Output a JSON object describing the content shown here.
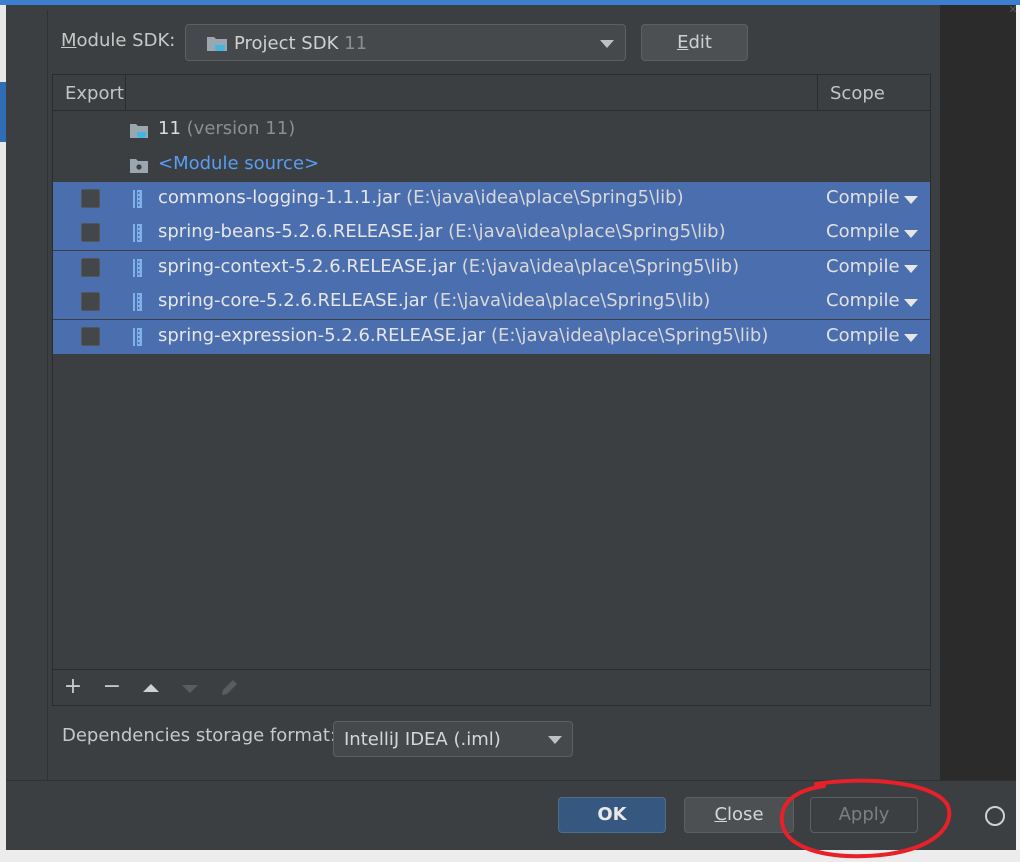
{
  "sdk": {
    "label_mnemonic": "M",
    "label_rest": "odule SDK:",
    "value_name": "Project SDK",
    "value_version": "11",
    "edit_mnemonic": "E",
    "edit_rest": "dit"
  },
  "table": {
    "headers": {
      "export": "Export",
      "scope": "Scope"
    },
    "sdk_entry": {
      "name": "11",
      "version": "(version 11)"
    },
    "module_source": "<Module source>",
    "rows": [
      {
        "jar": "commons-logging-1.1.1.jar",
        "path": "(E:\\java\\idea\\place\\Spring5\\lib)",
        "scope": "Compile",
        "exported": false
      },
      {
        "jar": "spring-beans-5.2.6.RELEASE.jar",
        "path": "(E:\\java\\idea\\place\\Spring5\\lib)",
        "scope": "Compile",
        "exported": false
      },
      {
        "jar": "spring-context-5.2.6.RELEASE.jar",
        "path": "(E:\\java\\idea\\place\\Spring5\\lib)",
        "scope": "Compile",
        "exported": false
      },
      {
        "jar": "spring-core-5.2.6.RELEASE.jar",
        "path": "(E:\\java\\idea\\place\\Spring5\\lib)",
        "scope": "Compile",
        "exported": false
      },
      {
        "jar": "spring-expression-5.2.6.RELEASE.jar",
        "path": "(E:\\java\\idea\\place\\Spring5\\lib)",
        "scope": "Compile",
        "exported": false
      }
    ],
    "toolbar_icons": [
      "plus-icon",
      "minus-icon",
      "move-up-icon",
      "move-down-icon",
      "edit-pencil-icon"
    ]
  },
  "storage": {
    "label": "Dependencies storage format:",
    "value": "IntelliJ IDEA (.iml)"
  },
  "footer": {
    "ok": "OK",
    "close_mnemonic": "C",
    "close_rest": "lose",
    "apply": "Apply",
    "apply_enabled": false
  },
  "colors": {
    "dialog_bg": "#3c3f41",
    "selection": "#4b6eaf",
    "link_blue": "#589df6",
    "default_button": "#365880",
    "annotation_red": "#e8202a"
  }
}
